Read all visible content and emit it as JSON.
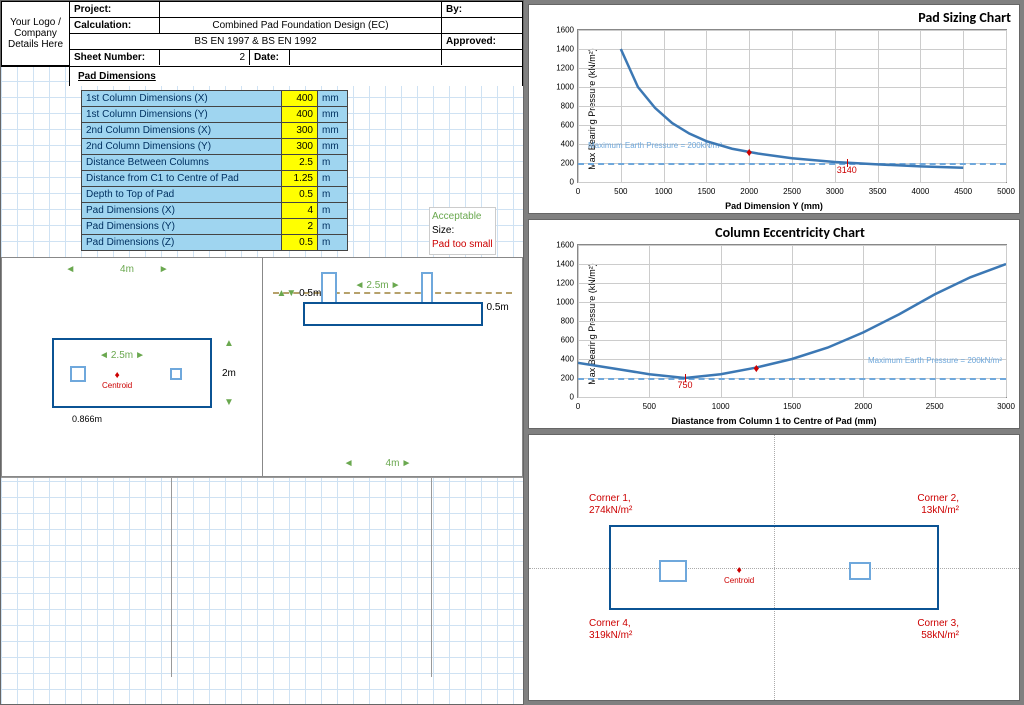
{
  "header": {
    "logo": "Your Logo / Company Details Here",
    "project_label": "Project:",
    "project": "",
    "calc_label": "Calculation:",
    "calc": "Combined Pad Foundation Design (EC)",
    "sub": "BS EN 1997 & BS EN 1992",
    "sheet_label": "Sheet Number:",
    "sheet": "2",
    "date_label": "Date:",
    "date": "",
    "by_label": "By:",
    "by": "",
    "approved_label": "Approved:",
    "approved": ""
  },
  "section": "Pad Dimensions",
  "dims": [
    {
      "label": "1st Column Dimensions (X)",
      "val": "400",
      "unit": "mm"
    },
    {
      "label": "1st Column Dimensions (Y)",
      "val": "400",
      "unit": "mm"
    },
    {
      "label": "2nd Column Dimensions (X)",
      "val": "300",
      "unit": "mm"
    },
    {
      "label": "2nd Column Dimensions (Y)",
      "val": "300",
      "unit": "mm"
    },
    {
      "label": "Distance Between Columns",
      "val": "2.5",
      "unit": "m"
    },
    {
      "label": "Distance from C1 to Centre of Pad",
      "val": "1.25",
      "unit": "m"
    },
    {
      "label": "Depth to Top of Pad",
      "val": "0.5",
      "unit": "m"
    },
    {
      "label": "Pad Dimensions (X)",
      "val": "4",
      "unit": "m"
    },
    {
      "label": "Pad Dimensions (Y)",
      "val": "2",
      "unit": "m"
    },
    {
      "label": "Pad Dimensions (Z)",
      "val": "0.5",
      "unit": "m"
    }
  ],
  "status": {
    "acc": "Acceptable",
    "size": "Size:",
    "small": "Pad too small"
  },
  "plan": {
    "width": "4m",
    "height": "2m",
    "spacing": "2.5m",
    "offset": "0.866m",
    "centroid": "Centroid"
  },
  "elev": {
    "spacing": "2.5m",
    "depth": "0.5m",
    "thick": "0.5m",
    "width": "4m"
  },
  "chart_data": [
    {
      "type": "line",
      "title": "Pad Sizing Chart",
      "xlabel": "Pad Dimension Y (mm)",
      "ylabel": "Max Bearing Pressure (kN/m²)",
      "xlim": [
        0,
        5000
      ],
      "ylim": [
        0,
        1600
      ],
      "xticks": [
        0,
        500,
        1000,
        1500,
        2000,
        2500,
        3000,
        3500,
        4000,
        4500,
        5000
      ],
      "yticks": [
        0,
        200,
        400,
        600,
        800,
        1000,
        1200,
        1400,
        1600
      ],
      "ref_y": 200,
      "ref_label": "Maximum Earth Pressure = 200kN/m²",
      "marker": {
        "x": 2000,
        "y": 320
      },
      "ref_x": 3140,
      "x": [
        500,
        700,
        900,
        1100,
        1300,
        1500,
        1800,
        2100,
        2500,
        3000,
        3500,
        4000,
        4500
      ],
      "y": [
        1400,
        1000,
        780,
        620,
        510,
        430,
        350,
        300,
        250,
        210,
        185,
        165,
        150
      ]
    },
    {
      "type": "line",
      "title": "Column Eccentricity Chart",
      "xlabel": "Diastance from Column 1 to Centre of Pad (mm)",
      "ylabel": "Max Bearing Pressure (kN/m²)",
      "xlim": [
        0,
        3000
      ],
      "ylim": [
        0,
        1600
      ],
      "xticks": [
        0,
        500,
        1000,
        1500,
        2000,
        2500,
        3000
      ],
      "yticks": [
        0,
        200,
        400,
        600,
        800,
        1000,
        1200,
        1400,
        1600
      ],
      "ref_y": 200,
      "ref_label": "Maximum Earth Pressure = 200kN/m²",
      "marker": {
        "x": 1250,
        "y": 310
      },
      "ref_x": 750,
      "x": [
        0,
        250,
        500,
        750,
        1000,
        1250,
        1500,
        1750,
        2000,
        2250,
        2500,
        2750,
        3000
      ],
      "y": [
        360,
        300,
        240,
        200,
        240,
        310,
        400,
        520,
        680,
        870,
        1080,
        1260,
        1400
      ]
    }
  ],
  "corners": {
    "centroid": "Centroid",
    "c1": {
      "name": "Corner 1,",
      "val": "274kN/m²"
    },
    "c2": {
      "name": "Corner 2,",
      "val": "13kN/m²"
    },
    "c3": {
      "name": "Corner 3,",
      "val": "58kN/m²"
    },
    "c4": {
      "name": "Corner 4,",
      "val": "319kN/m²"
    }
  }
}
